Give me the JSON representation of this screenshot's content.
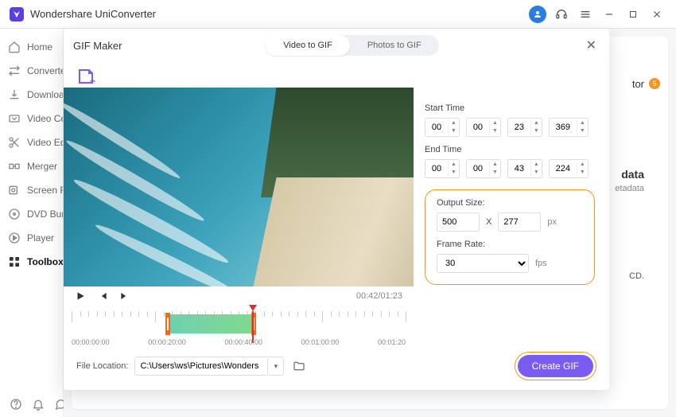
{
  "app": {
    "title": "Wondershare UniConverter"
  },
  "sidebar": {
    "items": [
      {
        "label": "Home"
      },
      {
        "label": "Converter"
      },
      {
        "label": "Downloader"
      },
      {
        "label": "Video Compressor"
      },
      {
        "label": "Video Editor"
      },
      {
        "label": "Merger"
      },
      {
        "label": "Screen Recorder"
      },
      {
        "label": "DVD Burner"
      },
      {
        "label": "Player"
      },
      {
        "label": "Toolbox"
      }
    ]
  },
  "background": {
    "right_label": "tor",
    "badge": "5",
    "data_title": "data",
    "data_sub": "etadata",
    "cd_text": "CD."
  },
  "modal": {
    "title": "GIF Maker",
    "tabs": {
      "video": "Video to GIF",
      "photos": "Photos to GIF"
    },
    "time": {
      "start_label": "Start Time",
      "end_label": "End Time",
      "start": {
        "h": "00",
        "m": "00",
        "s": "23",
        "ms": "369"
      },
      "end": {
        "h": "00",
        "m": "00",
        "s": "43",
        "ms": "224"
      }
    },
    "output": {
      "size_label": "Output Size:",
      "width": "500",
      "x": "X",
      "height": "277",
      "unit": "px",
      "rate_label": "Frame Rate:",
      "rate": "30",
      "rate_unit": "fps"
    },
    "player": {
      "current": "00:42",
      "total": "01:23"
    },
    "timeline": {
      "labels": [
        "00:00:00:00",
        "00:00:20:00",
        "00:00:40:00",
        "00:01:00:00",
        "00:01:20"
      ]
    },
    "footer": {
      "location_label": "File Location:",
      "path": "C:\\Users\\ws\\Pictures\\Wonders",
      "create": "Create GIF"
    }
  }
}
